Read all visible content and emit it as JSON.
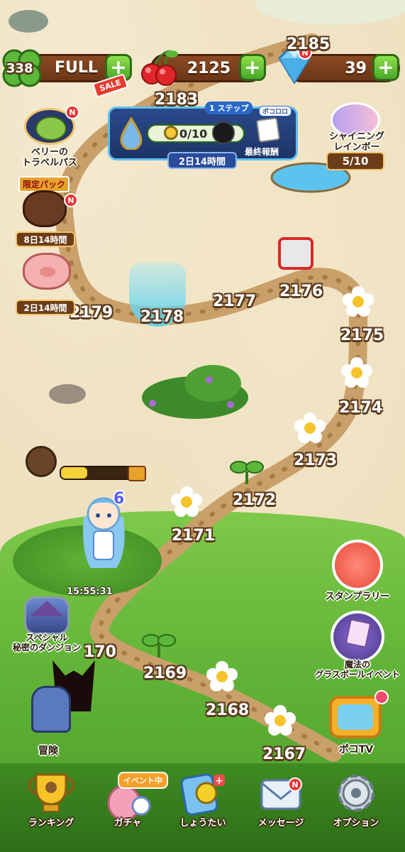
{
  "resources": {
    "lives": {
      "count": "338",
      "status": "FULL",
      "sale_tag": "SALE"
    },
    "cherries": {
      "count": "2125"
    },
    "gems": {
      "count": "39"
    },
    "new_badge": "N"
  },
  "event_banner": {
    "step_label": "1 ステップ",
    "progress": "0/10",
    "reward_tag": "ポコロロ",
    "reward_label": "最終報酬",
    "timer": "2日14時間"
  },
  "side_left": {
    "travel_pass": {
      "label_line1": "ベリーの",
      "label_line2": "トラベルパス"
    },
    "limited_pack": {
      "tag": "限定パック",
      "timer": "8日14時間"
    },
    "piggy_bank": {
      "timer": "2日14時間"
    },
    "special_dungeon": {
      "timer": "15:55:31",
      "label_line1": "スペシャル",
      "label_line2": "秘密のダンジョン"
    },
    "adventure": {
      "label": "冒険"
    }
  },
  "side_right": {
    "shining_rainbow": {
      "label_line1": "シャイニング",
      "label_line2": "レインボー",
      "progress": "5/10"
    },
    "stamp_rally": {
      "label": "スタンプラリー"
    },
    "magic_glassball": {
      "label_line1": "魔法の",
      "label_line2": "グラスボールイベント"
    },
    "poko_tv": {
      "label": "ポコTV"
    }
  },
  "levels": {
    "l2185": "2185",
    "l2183": "2183",
    "l2179": "2179",
    "l2178": "2178",
    "l2177": "2177",
    "l2176": "2176",
    "l2175": "2175",
    "l2174": "2174",
    "l2173": "2173",
    "l2172": "2172",
    "l2171": "2171",
    "l2170": "170",
    "l2169": "2169",
    "l2168": "2168",
    "l2167": "2167"
  },
  "player": {
    "level_badge": "6"
  },
  "bottom_nav": {
    "ranking": "ランキング",
    "gacha": "ガチャ",
    "gacha_event_tag": "イベント中",
    "invite": "しょうたい",
    "message": "メッセージ",
    "options": "オプション"
  },
  "colors": {
    "brown_bar": "#6b3617",
    "green_plus": "#4aa82a",
    "badge_red": "#e8322e",
    "grass": "#5fb236"
  }
}
